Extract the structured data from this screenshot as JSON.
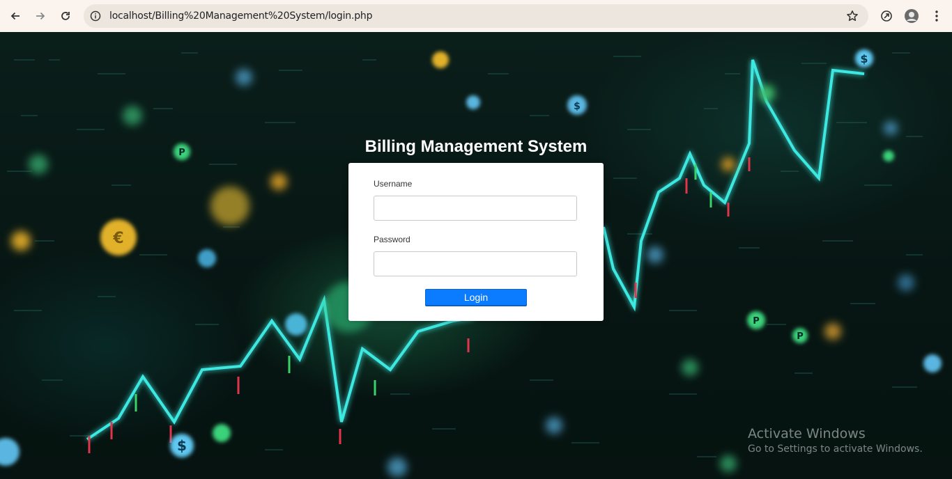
{
  "browser": {
    "url": "localhost/Billing%20Management%20System/login.php",
    "icons": [
      "back-arrow-icon",
      "forward-arrow-icon",
      "reload-icon",
      "site-info-icon",
      "bookmark-star-icon",
      "extension-icon",
      "profile-avatar",
      "menu-kebab-icon"
    ]
  },
  "page": {
    "title": "Billing Management System",
    "username_label": "Username",
    "username_value": "",
    "password_label": "Password",
    "password_value": "",
    "login_label": "Login"
  },
  "watermark": {
    "line1": "Activate Windows",
    "line2": "Go to Settings to activate Windows."
  },
  "colors": {
    "chrome_bg": "#fbf4ee",
    "button_blue": "#0b7cff",
    "chart_line": "#3de8e0"
  }
}
